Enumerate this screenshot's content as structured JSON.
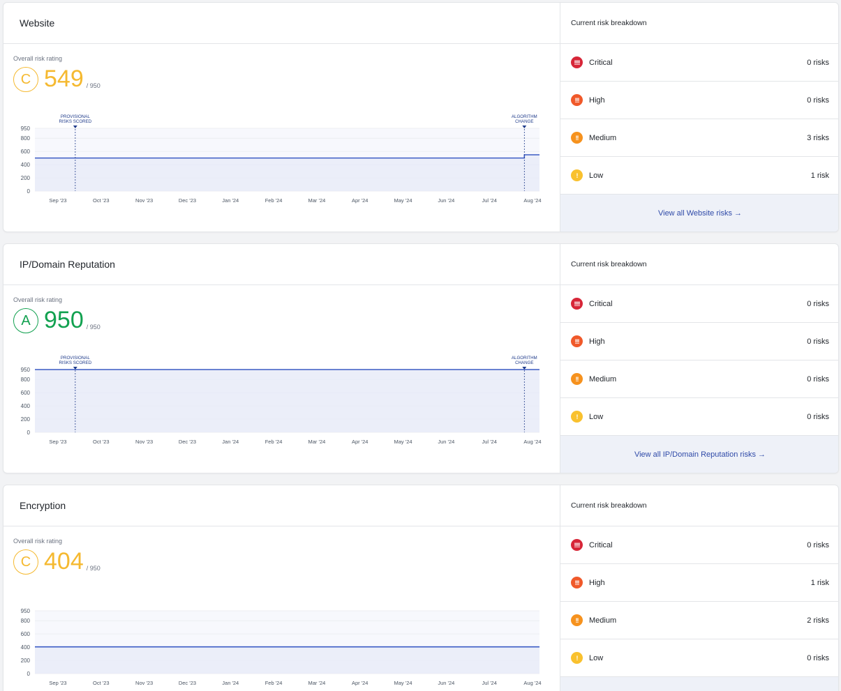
{
  "cards": [
    {
      "title": "Website",
      "rating_label": "Overall risk rating",
      "grade": "C",
      "score": "549",
      "max": "/ 950",
      "color": "#f5b930",
      "breakdown_title": "Current risk breakdown",
      "risks": [
        {
          "level": "Critical",
          "icon": "!!!!",
          "color": "#d72638",
          "count": "0 risks"
        },
        {
          "level": "High",
          "icon": "!!!",
          "color": "#f0592a",
          "count": "0 risks"
        },
        {
          "level": "Medium",
          "icon": "!!",
          "color": "#f6921e",
          "count": "3 risks"
        },
        {
          "level": "Low",
          "icon": "!",
          "color": "#f9c12e",
          "count": "1 risk"
        }
      ],
      "view_all": "View all Website risks →",
      "chart_data": {
        "type": "line",
        "x": [
          "Sep '23",
          "Oct '23",
          "Nov '23",
          "Dec '23",
          "Jan '24",
          "Feb '24",
          "Mar '24",
          "Apr '24",
          "May '24",
          "Jun '24",
          "Jul '24",
          "Aug '24"
        ],
        "y_ticks": [
          "950",
          "800",
          "600",
          "400",
          "200",
          "0"
        ],
        "ylim": [
          0,
          950
        ],
        "series": [
          {
            "points": [
              [
                0.0,
                500
              ],
              [
                0.97,
                500
              ],
              [
                0.97,
                549
              ],
              [
                1.0,
                549
              ]
            ]
          }
        ],
        "annotations": [
          {
            "lines": [
              "PROVISIONAL",
              "RISKS SCORED"
            ],
            "at": 0.08
          },
          {
            "lines": [
              "ALGORITHM",
              "CHANGE"
            ],
            "at": 0.97
          }
        ]
      }
    },
    {
      "title": "IP/Domain Reputation",
      "rating_label": "Overall risk rating",
      "grade": "A",
      "score": "950",
      "max": "/ 950",
      "color": "#12a150",
      "breakdown_title": "Current risk breakdown",
      "risks": [
        {
          "level": "Critical",
          "icon": "!!!!",
          "color": "#d72638",
          "count": "0 risks"
        },
        {
          "level": "High",
          "icon": "!!!",
          "color": "#f0592a",
          "count": "0 risks"
        },
        {
          "level": "Medium",
          "icon": "!!",
          "color": "#f6921e",
          "count": "0 risks"
        },
        {
          "level": "Low",
          "icon": "!",
          "color": "#f9c12e",
          "count": "0 risks"
        }
      ],
      "view_all": "View all IP/Domain Reputation risks →",
      "chart_data": {
        "type": "line",
        "x": [
          "Sep '23",
          "Oct '23",
          "Nov '23",
          "Dec '23",
          "Jan '24",
          "Feb '24",
          "Mar '24",
          "Apr '24",
          "May '24",
          "Jun '24",
          "Jul '24",
          "Aug '24"
        ],
        "y_ticks": [
          "950",
          "800",
          "600",
          "400",
          "200",
          "0"
        ],
        "ylim": [
          0,
          950
        ],
        "series": [
          {
            "points": [
              [
                0.0,
                950
              ],
              [
                1.0,
                950
              ]
            ]
          }
        ],
        "annotations": [
          {
            "lines": [
              "PROVISIONAL",
              "RISKS SCORED"
            ],
            "at": 0.08
          },
          {
            "lines": [
              "ALGORITHM",
              "CHANGE"
            ],
            "at": 0.97
          }
        ]
      }
    },
    {
      "title": "Encryption",
      "rating_label": "Overall risk rating",
      "grade": "C",
      "score": "404",
      "max": "/ 950",
      "color": "#f5b930",
      "breakdown_title": "Current risk breakdown",
      "risks": [
        {
          "level": "Critical",
          "icon": "!!!!",
          "color": "#d72638",
          "count": "0 risks"
        },
        {
          "level": "High",
          "icon": "!!!",
          "color": "#f0592a",
          "count": "1 risk"
        },
        {
          "level": "Medium",
          "icon": "!!",
          "color": "#f6921e",
          "count": "2 risks"
        },
        {
          "level": "Low",
          "icon": "!",
          "color": "#f9c12e",
          "count": "0 risks"
        }
      ],
      "view_all": "",
      "chart_data": {
        "type": "line",
        "x": [
          "Sep '23",
          "Oct '23",
          "Nov '23",
          "Dec '23",
          "Jan '24",
          "Feb '24",
          "Mar '24",
          "Apr '24",
          "May '24",
          "Jun '24",
          "Jul '24",
          "Aug '24"
        ],
        "y_ticks": [
          "950",
          "800",
          "600",
          "400",
          "200",
          "0"
        ],
        "ylim": [
          0,
          950
        ],
        "series": [
          {
            "points": [
              [
                0.0,
                404
              ],
              [
                1.0,
                404
              ]
            ]
          }
        ],
        "annotations": []
      }
    }
  ]
}
